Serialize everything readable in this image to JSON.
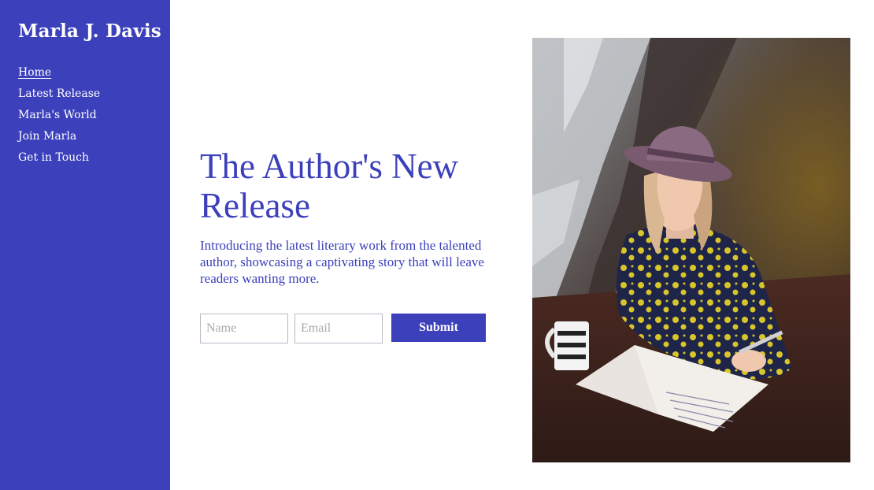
{
  "brand": {
    "name": "Marla J. Davis"
  },
  "nav": {
    "items": [
      {
        "label": "Home",
        "active": true
      },
      {
        "label": "Latest Release",
        "active": false
      },
      {
        "label": "Marla's World",
        "active": false
      },
      {
        "label": "Join Marla",
        "active": false
      },
      {
        "label": "Get in Touch",
        "active": false
      }
    ]
  },
  "hero": {
    "title": "The Author's New Release",
    "description": "Introducing the latest literary work from the talented author, showcasing a captivating story that will leave readers wanting more."
  },
  "signup": {
    "name_placeholder": "Name",
    "email_placeholder": "Email",
    "submit_label": "Submit"
  },
  "colors": {
    "accent": "#3c40bb",
    "background": "#ffffff",
    "nav_text": "#ffffff"
  },
  "photo": {
    "subject": "woman in hat writing in notebook"
  }
}
